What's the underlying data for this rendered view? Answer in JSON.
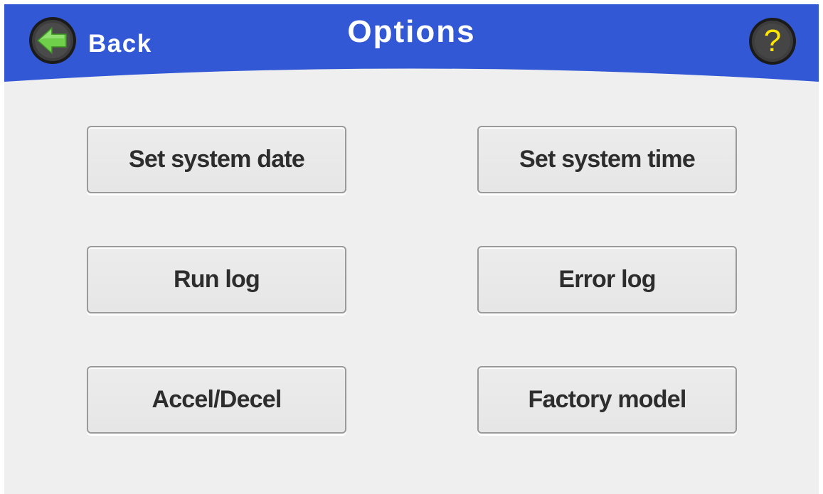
{
  "header": {
    "title": "Options",
    "back_label": "Back",
    "back_icon": "back-arrow-icon",
    "help_icon": "help-icon",
    "help_glyph": "?"
  },
  "menu": {
    "set_system_date": "Set system date",
    "set_system_time": "Set system time",
    "run_log": "Run log",
    "error_log": "Error log",
    "accel_decel": "Accel/Decel",
    "factory_model": "Factory model"
  },
  "colors": {
    "header_blue": "#3258d6",
    "background": "#efefef",
    "back_arrow_green": "#7ed957",
    "help_yellow": "#ffe600",
    "button_border": "#9a9a9a",
    "button_text": "#2d2d2d"
  }
}
